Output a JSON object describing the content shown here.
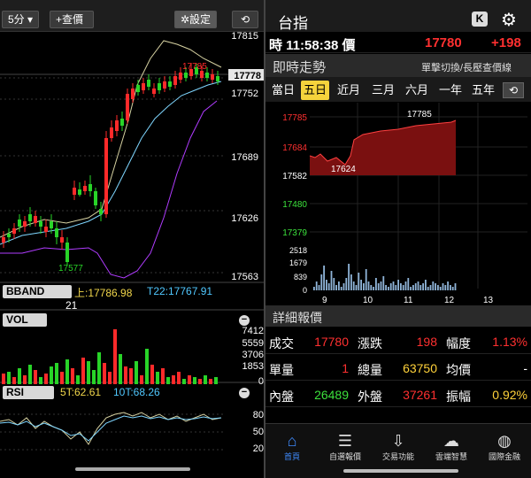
{
  "left": {
    "toolbar": {
      "interval": "5分",
      "add_label": "+查價",
      "settings_label": "✲設定",
      "rotate_label": "⟲"
    },
    "price_axis": [
      "17815",
      "17778",
      "17752",
      "17689",
      "17626",
      "17563"
    ],
    "current_price_tag": "17778",
    "high_label": "17785",
    "low_label": "17577",
    "bband": {
      "label": "BBAND",
      "upper": "上:17786.98",
      "t22": "T22:17767.91"
    },
    "vol": {
      "label": "VOL",
      "bar_count": "21",
      "axis": [
        "7412",
        "5559",
        "3706",
        "1853",
        "0"
      ]
    },
    "rsi": {
      "label": "RSI",
      "t5": "5T:62.61",
      "t10": "10T:68.26",
      "axis": [
        "80",
        "50",
        "20"
      ]
    },
    "colors": {
      "up": "#ff2a2a",
      "down": "#28d428",
      "ma_upper": "#d7d2a2",
      "ma_mid": "#7fd6ff",
      "lower_band": "#b03cff"
    }
  },
  "right": {
    "header": {
      "title": "台指",
      "k_label": "K",
      "gear": "settings"
    },
    "quote": {
      "time": "時 11:58:38 價",
      "price": "17780",
      "change": "+198"
    },
    "section_title": "即時走勢",
    "section_hint": "單擊切換/長壓查價線",
    "tabs": [
      "當日",
      "五日",
      "近月",
      "三月",
      "六月",
      "一年",
      "五年"
    ],
    "active_tab": "五日",
    "trend": {
      "axis": [
        "17785",
        "17684",
        "17582",
        "17480",
        "17379"
      ],
      "high_label": "17785",
      "low_label": "17624",
      "vol_axis": [
        "2518",
        "1679",
        "839",
        "0"
      ],
      "dates": [
        "9",
        "10",
        "11",
        "12",
        "13"
      ]
    },
    "detail_title": "詳細報價",
    "details": [
      {
        "l1": "成交",
        "v1": "17780",
        "c1": "red",
        "l2": "漲跌",
        "v2": "198",
        "c2": "red",
        "l3": "幅度",
        "v3": "1.13%",
        "c3": "red"
      },
      {
        "l1": "單量",
        "v1": "1",
        "c1": "red",
        "l2": "總量",
        "v2": "63750",
        "c2": "yellow",
        "l3": "均價",
        "v3": "-",
        "c3": "white"
      },
      {
        "l1": "內盤",
        "v1": "26489",
        "c1": "green",
        "l2": "外盤",
        "v2": "37261",
        "c2": "red",
        "l3": "振幅",
        "v3": "0.92%",
        "c3": "yellow"
      }
    ],
    "nav": [
      {
        "label": "首頁",
        "icon": "home-icon"
      },
      {
        "label": "自選報價",
        "icon": "list-icon"
      },
      {
        "label": "交易功能",
        "icon": "trade-icon"
      },
      {
        "label": "雲端智慧",
        "icon": "cloud-icon"
      },
      {
        "label": "國際金融",
        "icon": "globe-icon"
      }
    ]
  }
}
